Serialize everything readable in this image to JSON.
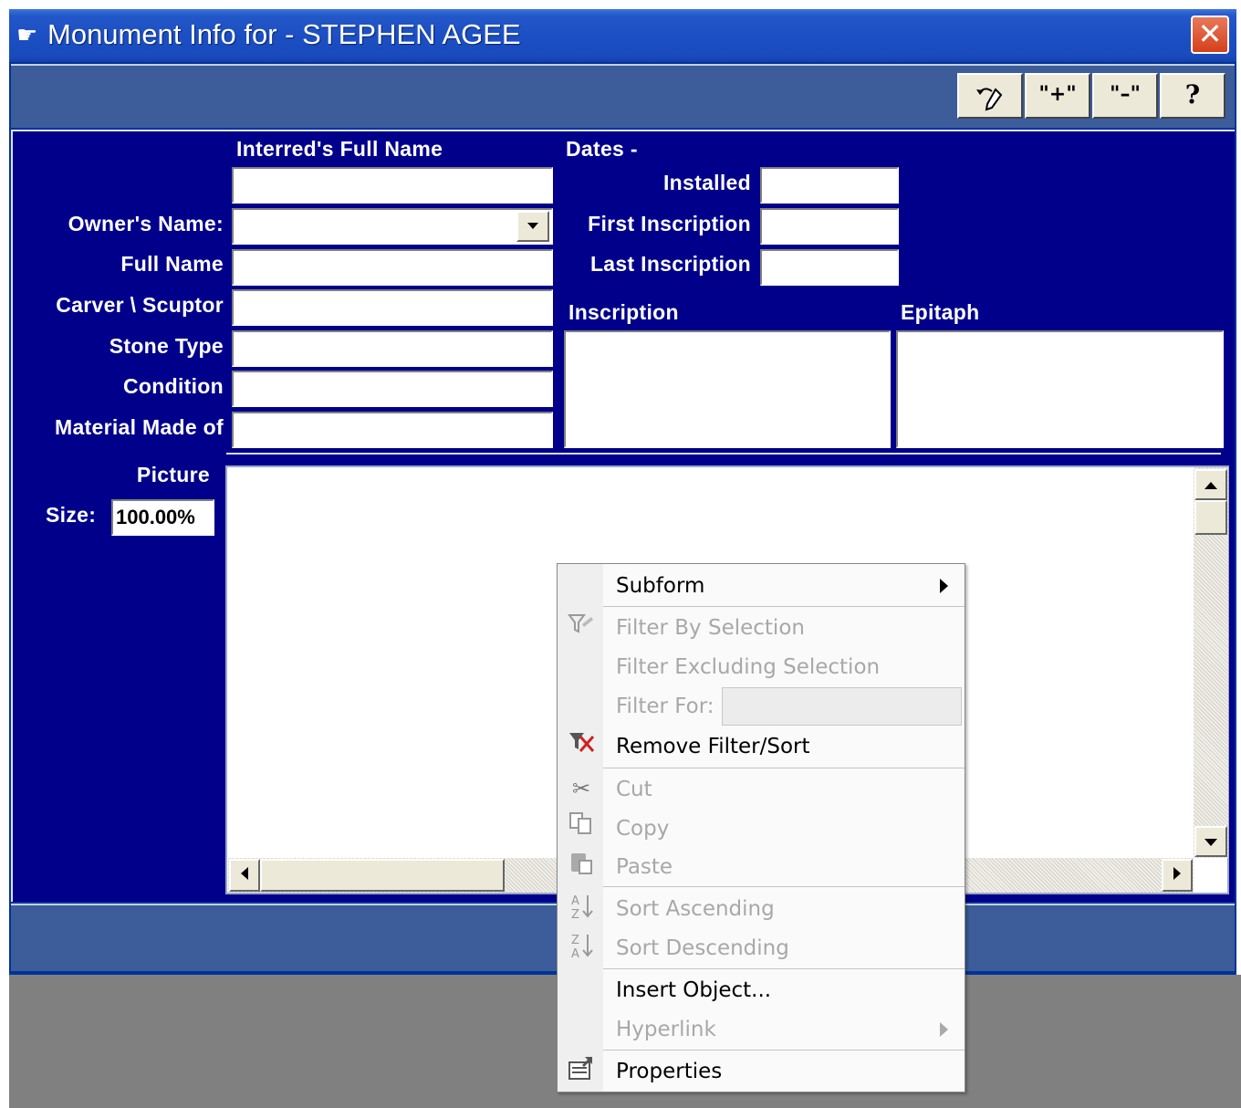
{
  "window": {
    "title": "Monument Info for - STEPHEN AGEE",
    "close_glyph": "✕",
    "app_icon": "pointing-hand-icon"
  },
  "toolbar": {
    "buttons": [
      {
        "name": "undo-edit-button",
        "glyph": "↶",
        "icon": "undo-pencil-icon"
      },
      {
        "name": "add-record-button",
        "glyph": "\"+\"",
        "icon": "plus-icon"
      },
      {
        "name": "delete-record-button",
        "glyph": "\"–\"",
        "icon": "minus-icon"
      },
      {
        "name": "help-button",
        "glyph": "?",
        "icon": "help-icon"
      }
    ]
  },
  "form": {
    "interred_label": "Interred's Full Name",
    "interred_value": "",
    "owner_label": "Owner's Name:",
    "owner_value": "",
    "full_name_label": "Full Name",
    "full_name_value": "",
    "carver_label": "Carver \\ Scuptor",
    "carver_value": "",
    "stone_type_label": "Stone Type",
    "stone_type_value": "",
    "condition_label": "Condition",
    "condition_value": "",
    "material_label": "Material Made of",
    "material_value": "",
    "dates_label": "Dates -",
    "installed_label": "Installed",
    "installed_value": "",
    "first_inscription_label": "First Inscription",
    "first_inscription_value": "",
    "last_inscription_label": "Last Inscription",
    "last_inscription_value": "",
    "inscription_label": "Inscription",
    "inscription_value": "",
    "epitaph_label": "Epitaph",
    "epitaph_value": "",
    "picture_label": "Picture",
    "size_label": "Size:",
    "size_value": "100.00%"
  },
  "context_menu": {
    "subform": "Subform",
    "filter_by_selection": "Filter By Selection",
    "filter_excluding": "Filter Excluding Selection",
    "filter_for": "Filter For:",
    "filter_for_value": "",
    "remove_filter": "Remove Filter/Sort",
    "cut": "Cut",
    "copy": "Copy",
    "paste": "Paste",
    "sort_ascending": "Sort Ascending",
    "sort_descending": "Sort Descending",
    "insert_object": "Insert Object...",
    "hyperlink": "Hyperlink",
    "properties": "Properties"
  }
}
